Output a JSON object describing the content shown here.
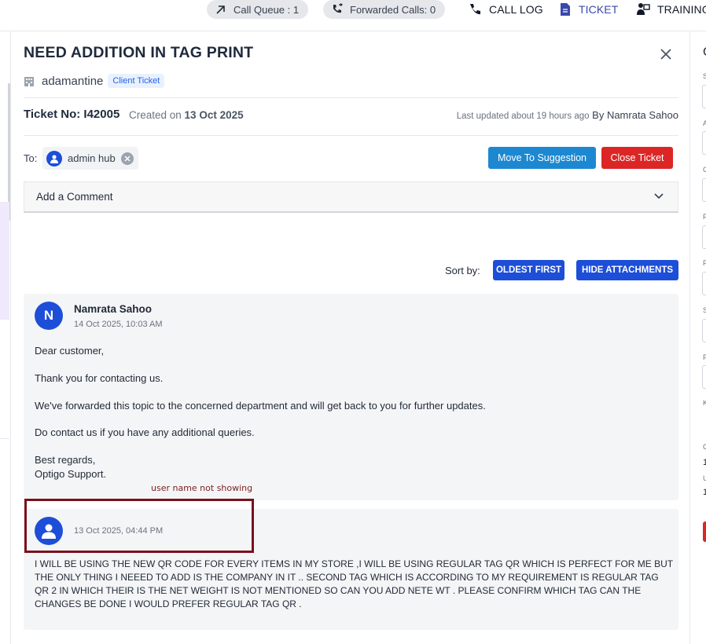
{
  "topbar": {
    "call_queue": "Call Queue : 1",
    "forwarded_calls": "Forwarded Calls: 0",
    "call_log": "CALL LOG",
    "ticket": "TICKET",
    "training": "TRAINING",
    "active_color": "#3949ab"
  },
  "ticket": {
    "title": "NEED ADDITION IN TAG PRINT",
    "company": "adamantine",
    "badge": "Client Ticket",
    "number_label": "Ticket No: I42005",
    "created_prefix": "Created on ",
    "created_date": "13 Oct 2025",
    "updated_text": "Last updated about 19 hours ago",
    "updated_by": "By Namrata Sahoo"
  },
  "recipients": {
    "to_label": "To:",
    "chip": "admin hub"
  },
  "actions": {
    "move_to_suggestion": "Move To Suggestion",
    "close_ticket": "Close Ticket"
  },
  "comment": {
    "placeholder": "Add a Comment"
  },
  "sort": {
    "label": "Sort by:",
    "oldest_first": "OLDEST FIRST",
    "hide_attachments": "HIDE ATTACHMENTS"
  },
  "messages": [
    {
      "avatar_letter": "N",
      "author": "Namrata Sahoo",
      "timestamp": "14 Oct 2025, 10:03 AM",
      "lines": [
        "Dear customer,",
        "Thank you for contacting us.",
        "We've forwarded this topic to the concerned department and will get back to you for further updates.",
        "Do contact us if you have any additional queries.",
        "Best regards,",
        "Optigo Support."
      ]
    },
    {
      "author": "",
      "timestamp": "13 Oct 2025, 04:44 PM",
      "body": "I WILL BE USING THE NEW QR CODE FOR EVERY ITEMS IN MY STORE ,I WILL BE USING REGULAR TAG QR WHICH IS PERFECT FOR ME BUT THE ONLY THING I NEEED TO ADD IS THE COMPANY IN IT .. SECOND TAG WHICH IS ACCORDING TO MY REQUIREMENT IS REGULAR TAG QR 2 IN WHICH THEIR IS THE NET WEIGHT IS NOT MENTIONED SO CAN YOU ADD NETE WT . PLEASE CONFIRM WHICH TAG CAN THE CHANGES BE DONE I WOULD PREFER REGULAR TAG QR ."
    }
  ],
  "annotation": {
    "note": "user name not showing",
    "color": "#7b0f1c"
  },
  "right_panel_letters": [
    "C",
    "S",
    "A",
    "C",
    "F",
    "F",
    "S",
    "F",
    "K",
    "C",
    "1",
    "U",
    "1"
  ]
}
